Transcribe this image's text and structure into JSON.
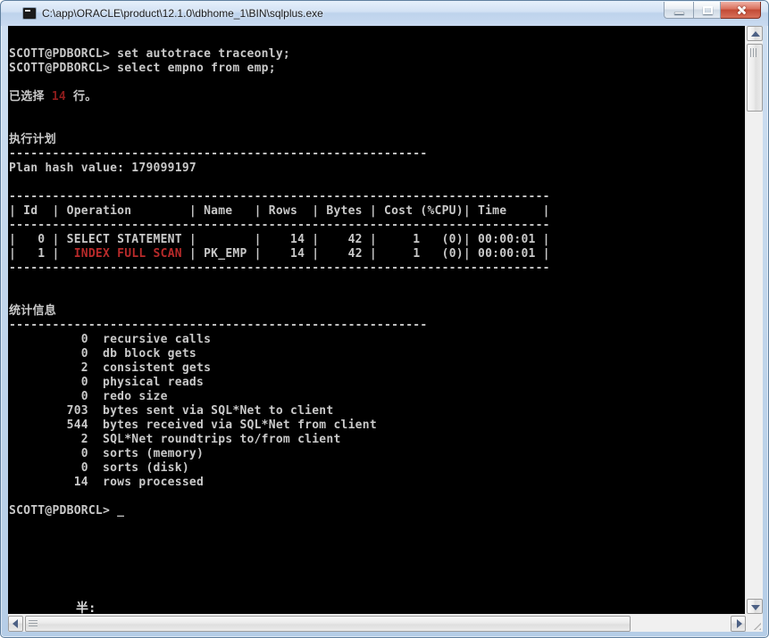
{
  "window": {
    "title": "C:\\app\\ORACLE\\product\\12.1.0\\dbhome_1\\BIN\\sqlplus.exe"
  },
  "colors": {
    "white": "#c9c9c9",
    "red": "#b82a2a",
    "darkred": "#8e1c1c"
  },
  "console": {
    "prompt": "SCOTT@PDBORCL>",
    "ime_indicator": "半:",
    "lines": [
      "SCOTT@PDBORCL> set autotrace traceonly;",
      "SCOTT@PDBORCL> select empno from emp;",
      "",
      {
        "segments": [
          {
            "t": "已选择 "
          },
          {
            "t": "14",
            "c": "darkred"
          },
          {
            "t": " 行。"
          }
        ]
      },
      "",
      "",
      "执行计划",
      "----------------------------------------------------------",
      "Plan hash value: 179099197",
      "",
      "---------------------------------------------------------------------------",
      "| Id  | Operation        | Name   | Rows  | Bytes | Cost (%CPU)| Time     |",
      "---------------------------------------------------------------------------",
      "|   0 | SELECT STATEMENT |        |    14 |    42 |     1   (0)| 00:00:01 |",
      {
        "segments": [
          {
            "t": "|   1 |  "
          },
          {
            "t": "INDEX FULL SCAN",
            "c": "red"
          },
          {
            "t": " | PK_EMP |    14 |    42 |     1   (0)| 00:00:01 |"
          }
        ]
      },
      "---------------------------------------------------------------------------",
      "",
      "",
      "统计信息",
      "----------------------------------------------------------",
      "          0  recursive calls",
      "          0  db block gets",
      "          2  consistent gets",
      "          0  physical reads",
      "          0  redo size",
      "        703  bytes sent via SQL*Net to client",
      "        544  bytes received via SQL*Net from client",
      "          2  SQL*Net roundtrips to/from client",
      "          0  sorts (memory)",
      "          0  sorts (disk)",
      "         14  rows processed",
      "",
      {
        "segments": [
          {
            "t": "SCOTT@PDBORCL> "
          },
          {
            "t": "_",
            "c": "cursor"
          }
        ]
      }
    ]
  }
}
